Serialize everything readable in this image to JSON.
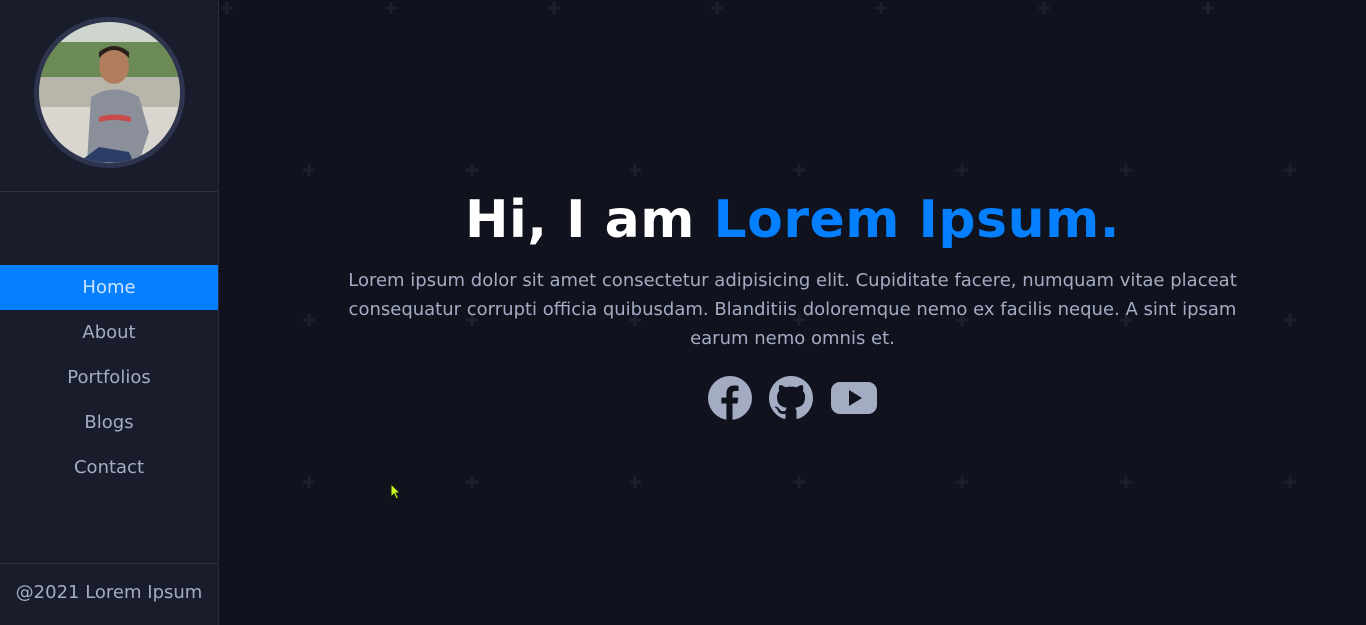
{
  "sidebar": {
    "nav": [
      {
        "label": "Home",
        "active": true
      },
      {
        "label": "About",
        "active": false
      },
      {
        "label": "Portfolios",
        "active": false
      },
      {
        "label": "Blogs",
        "active": false
      },
      {
        "label": "Contact",
        "active": false
      }
    ],
    "copyright": "@2021 Lorem Ipsum"
  },
  "hero": {
    "title_prefix": "Hi, I am ",
    "title_name": "Lorem Ipsum.",
    "text": "Lorem ipsum dolor sit amet consectetur adipisicing elit. Cupiditate facere, numquam vitae placeat consequatur corrupti officia quibusdam. Blanditiis doloremque nemo ex facilis neque. A sint ipsam earum nemo omnis et."
  },
  "socials": [
    {
      "icon": "facebook-icon"
    },
    {
      "icon": "github-icon"
    },
    {
      "icon": "youtube-icon"
    }
  ],
  "colors": {
    "accent": "#037fff",
    "sidebar_bg": "#191d2b",
    "main_bg": "#10121d",
    "text": "#a4acc4"
  }
}
